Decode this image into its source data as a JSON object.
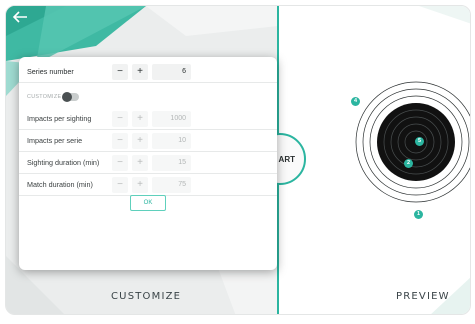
{
  "colors": {
    "accent": "#2bb5a0",
    "target_black": "#111111",
    "panel_bg": "#ebeded"
  },
  "header": {
    "back_icon": "arrow-left-icon"
  },
  "dialog": {
    "series_number": {
      "label": "Series number",
      "minus": "−",
      "plus": "+",
      "value": "6"
    },
    "customize": {
      "label": "CUSTOMIZE",
      "enabled": false
    },
    "rows": [
      {
        "label": "Impacts per sighting",
        "minus": "−",
        "plus": "+",
        "value": "1000"
      },
      {
        "label": "Impacts per serie",
        "minus": "−",
        "plus": "+",
        "value": "10"
      },
      {
        "label": "Sighting duration (min)",
        "minus": "−",
        "plus": "+",
        "value": "15"
      },
      {
        "label": "Match duration (min)",
        "minus": "−",
        "plus": "+",
        "value": "75"
      }
    ],
    "ok_label": "OK"
  },
  "start_button": {
    "label": "ART"
  },
  "left_footer": {
    "label": "CUSTOMIZE"
  },
  "right_footer": {
    "label": "PREVIEW"
  },
  "target": {
    "markers": [
      "4",
      "5",
      "2",
      "1"
    ]
  }
}
